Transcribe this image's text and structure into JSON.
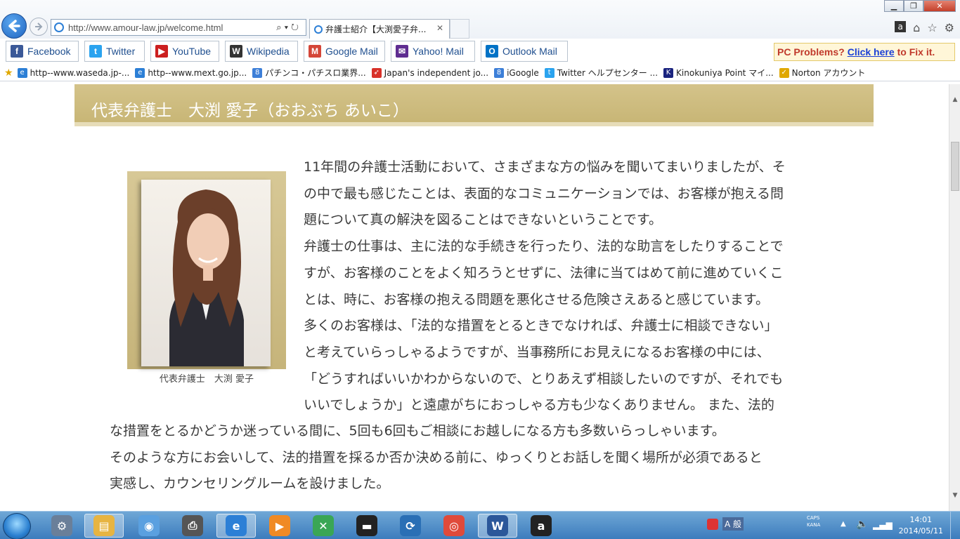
{
  "browser": {
    "address": "http://www.amour-law.jp/welcome.html",
    "tab_title": "弁護士紹介【大渕愛子弁...",
    "window_controls": [
      "minimize-icon",
      "restore-icon",
      "close-icon"
    ],
    "right_icons": [
      "a",
      "home-icon",
      "star-icon",
      "gear-icon"
    ]
  },
  "favorites": [
    {
      "label": "Facebook",
      "icon": "f",
      "color": "#3b5998"
    },
    {
      "label": "Twitter",
      "icon": "t",
      "color": "#2aa3ef"
    },
    {
      "label": "YouTube",
      "icon": "▶",
      "color": "#cc1f1f"
    },
    {
      "label": "Wikipedia",
      "icon": "W",
      "color": "#333333"
    },
    {
      "label": "Google Mail",
      "icon": "M",
      "color": "#d44638"
    },
    {
      "label": "Yahoo! Mail",
      "icon": "✉",
      "color": "#5f2d91"
    },
    {
      "label": "Outlook Mail",
      "icon": "O",
      "color": "#0072c6"
    }
  ],
  "pc_problems": {
    "prefix": "PC Problems?",
    "link": "Click here",
    "suffix": "to Fix it."
  },
  "bookmarks": [
    {
      "label": "http--www.waseda.jp-...",
      "icon": "e",
      "color": "#2c7fd6"
    },
    {
      "label": "http--www.mext.go.jp...",
      "icon": "e",
      "color": "#2c7fd6"
    },
    {
      "label": "パチンコ・パチスロ業界...",
      "icon": "8",
      "color": "#3d7fd8"
    },
    {
      "label": "Japan's independent jo...",
      "icon": "➶",
      "color": "#d8322a"
    },
    {
      "label": "iGoogle",
      "icon": "8",
      "color": "#3d7fd8"
    },
    {
      "label": "Twitter ヘルプセンター ...",
      "icon": "t",
      "color": "#2aa3ef"
    },
    {
      "label": "Kinokuniya Point マイ...",
      "icon": "K",
      "color": "#1a237e"
    },
    {
      "label": "Norton アカウント",
      "icon": "✓",
      "color": "#e0a800"
    }
  ],
  "page": {
    "banner": "代表弁護士　大渕 愛子（おおぶち あいこ）",
    "caption": "代表弁護士　大渕 愛子",
    "lines_narrow": [
      "11年間の弁護士活動において、さまざまな方の悩みを聞いてまいりましたが、そ",
      "の中で最も感じたことは、表面的なコミュニケーションでは、お客様が抱える問",
      "題について真の解決を図ることはできないということです。",
      "弁護士の仕事は、主に法的な手続きを行ったり、法的な助言をしたりすることで",
      "すが、お客様のことをよく知ろうとせずに、法律に当てはめて前に進めていくこ",
      "とは、時に、お客様の抱える問題を悪化させる危険さえあると感じています。",
      "多くのお客様は、「法的な措置をとるときでなければ、弁護士に相談できない」",
      "と考えていらっしゃるようですが、当事務所にお見えになるお客様の中には、",
      "「どうすればいいかわからないので、とりあえず相談したいのですが、それでも",
      "いいでしょうか」と遠慮がちにおっしゃる方も少なくありません。 また、法的"
    ],
    "lines_wide": [
      "な措置をとるかどうか迷っている間に、5回も6回もご相談にお越しになる方も多数いらっしゃいます。",
      "そのような方にお会いして、法的措置を採るか否か決める前に、ゆっくりとお話しを聞く場所が必須であると",
      "実感し、カウンセリングルームを設けました。"
    ]
  },
  "taskbar": {
    "apps": [
      {
        "name": "control-icon",
        "glyph": "⚙",
        "color": "#6a7f99"
      },
      {
        "name": "explorer-icon",
        "glyph": "▤",
        "color": "#e7b441"
      },
      {
        "name": "network-app-icon",
        "glyph": "◉",
        "color": "#5aa0e0"
      },
      {
        "name": "scanner-icon",
        "glyph": "⎙",
        "color": "#555555"
      },
      {
        "name": "internet-explorer-icon",
        "glyph": "e",
        "color": "#2c7fd6"
      },
      {
        "name": "media-icon",
        "glyph": "▶",
        "color": "#f08a24"
      },
      {
        "name": "tools-icon",
        "glyph": "✕",
        "color": "#3aa655"
      },
      {
        "name": "printer-icon",
        "glyph": "▬",
        "color": "#222222"
      },
      {
        "name": "remote-icon",
        "glyph": "⟳",
        "color": "#2a6fb5"
      },
      {
        "name": "chrome-icon",
        "glyph": "◎",
        "color": "#e04a3a"
      },
      {
        "name": "word-icon",
        "glyph": "W",
        "color": "#2b579a"
      },
      {
        "name": "amazon-icon",
        "glyph": "a",
        "color": "#222222"
      }
    ],
    "caps": "CAPS",
    "kana": "KANA",
    "time": "14:01",
    "date": "2014/05/11",
    "ime": "般"
  }
}
